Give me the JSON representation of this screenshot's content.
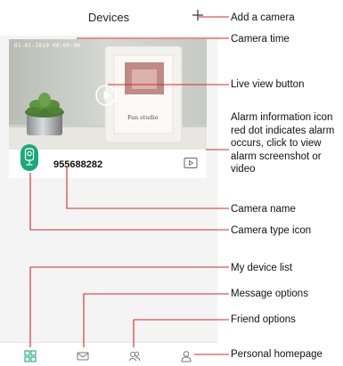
{
  "header": {
    "title": "Devices"
  },
  "camera_card": {
    "camera_time": "01-01-2019 00:00:00",
    "camera_name": "955688282",
    "photo_sign_text": "Fan studio"
  },
  "tabs": [
    {
      "name": "my-device-list",
      "icon": "grid-icon"
    },
    {
      "name": "message-options",
      "icon": "message-icon"
    },
    {
      "name": "friend-options",
      "icon": "friends-icon"
    },
    {
      "name": "personal-homepage",
      "icon": "person-icon"
    }
  ],
  "callouts": {
    "add_camera": "Add a camera",
    "camera_time": "Camera time",
    "live_view": "Live view button",
    "alarm_info": "Alarm information icon red dot indicates alarm occurs, click to view alarm screenshot or video",
    "camera_name": "Camera name",
    "camera_type_icon": "Camera type icon",
    "device_list": "My device list",
    "message_options": "Message options",
    "friend_options": "Friend options",
    "personal_homepage": "Personal homepage"
  },
  "colors": {
    "accent": "#19a97b",
    "line": "#d22b2b"
  }
}
